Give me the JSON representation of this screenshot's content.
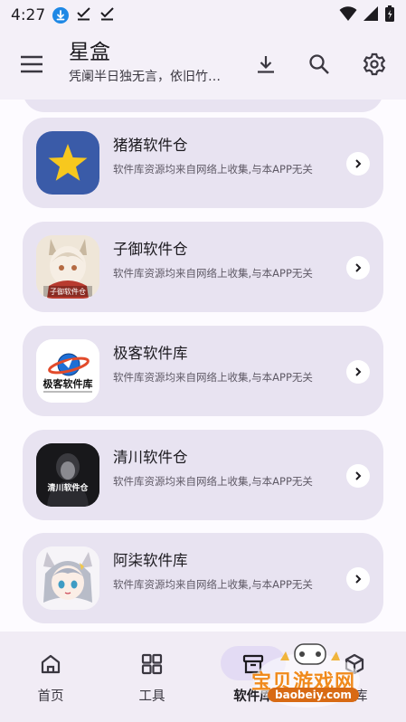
{
  "status_bar": {
    "time": "4:27",
    "icons": [
      "download-badge-icon",
      "check-download-icon",
      "check-download-icon"
    ],
    "right_icons": [
      "wifi-icon",
      "signal-icon",
      "battery-icon"
    ]
  },
  "app_bar": {
    "title": "星盒",
    "subtitle": "凭阑半日独无言，依旧竹…",
    "icons": [
      "menu-icon",
      "download-icon",
      "search-icon",
      "settings-icon"
    ]
  },
  "cards": [
    {
      "name": "猪猪软件仓",
      "desc": "软件库资源均来自网络上收集,与本APP无关",
      "logo": "star-logo"
    },
    {
      "name": "子御软件仓",
      "desc": "软件库资源均来自网络上收集,与本APP无关",
      "logo": "anime-cat-logo",
      "logo_text": "子御软件仓"
    },
    {
      "name": "极客软件库",
      "desc": "软件库资源均来自网络上收集,与本APP无关",
      "logo": "planet-logo",
      "logo_text": "极客软件库"
    },
    {
      "name": "清川软件仓",
      "desc": "软件库资源均来自网络上收集,与本APP无关",
      "logo": "dark-figure-logo",
      "logo_text": "清川软件仓"
    },
    {
      "name": "阿柒软件库",
      "desc": "软件库资源均来自网络上收集,与本APP无关",
      "logo": "anime-girl-logo"
    }
  ],
  "bottom_nav": {
    "items": [
      {
        "label": "首页",
        "icon": "home-icon",
        "active": false
      },
      {
        "label": "工具",
        "icon": "grid-icon",
        "active": false
      },
      {
        "label": "软件库",
        "icon": "archive-icon",
        "active": true
      },
      {
        "label": "仓库",
        "icon": "box-icon",
        "active": false
      }
    ]
  },
  "watermark": {
    "text": "宝贝游戏网",
    "url": "baobeiy.com"
  },
  "colors": {
    "card_bg": "#e8e3f1",
    "page_bg": "#fdfbff",
    "app_bar_bg": "#f4f0f8",
    "active_pill": "#e3dbf4",
    "star_logo_bg": "#3a5ba8",
    "star": "#f7c81e"
  }
}
